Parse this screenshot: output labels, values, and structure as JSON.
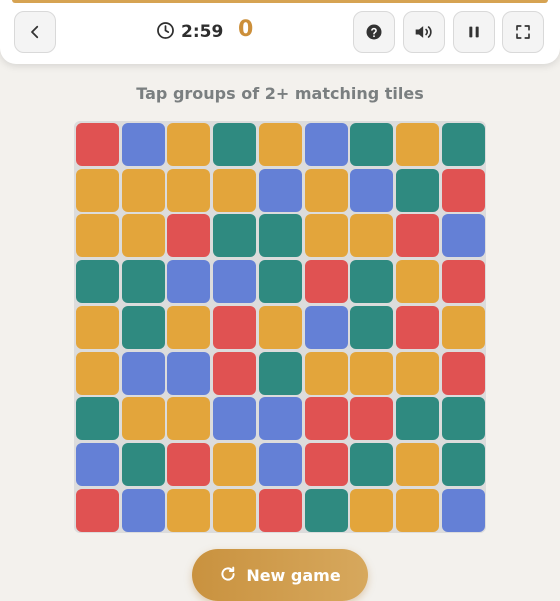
{
  "header": {
    "timer": "2:59",
    "score": "0",
    "accent_color": "#d6a352",
    "score_color": "#cc8f3a"
  },
  "toolbar": {
    "back_icon": "chevron-left-icon",
    "help_icon": "help-icon",
    "sound_icon": "sound-on-icon",
    "pause_icon": "pause-icon",
    "fullscreen_icon": "fullscreen-icon"
  },
  "hint": "Tap groups of 2+ matching tiles",
  "palette": {
    "R": "#e05252",
    "B": "#6480d6",
    "Y": "#e3a53b",
    "T": "#2f8a80"
  },
  "board": {
    "rows": [
      [
        "R",
        "B",
        "Y",
        "T",
        "Y",
        "B",
        "T",
        "Y",
        "T"
      ],
      [
        "Y",
        "Y",
        "Y",
        "Y",
        "B",
        "Y",
        "B",
        "T",
        "R"
      ],
      [
        "Y",
        "Y",
        "R",
        "T",
        "T",
        "Y",
        "Y",
        "R",
        "B"
      ],
      [
        "T",
        "T",
        "B",
        "B",
        "T",
        "R",
        "T",
        "Y",
        "R"
      ],
      [
        "Y",
        "T",
        "Y",
        "R",
        "Y",
        "B",
        "T",
        "R",
        "Y"
      ],
      [
        "Y",
        "B",
        "B",
        "R",
        "T",
        "Y",
        "Y",
        "Y",
        "R"
      ],
      [
        "T",
        "Y",
        "Y",
        "B",
        "B",
        "R",
        "R",
        "T",
        "T"
      ],
      [
        "B",
        "T",
        "R",
        "Y",
        "B",
        "R",
        "T",
        "Y",
        "T"
      ],
      [
        "R",
        "B",
        "Y",
        "Y",
        "R",
        "T",
        "Y",
        "Y",
        "B"
      ]
    ]
  },
  "new_game": {
    "label": "New game",
    "icon": "refresh-icon"
  }
}
